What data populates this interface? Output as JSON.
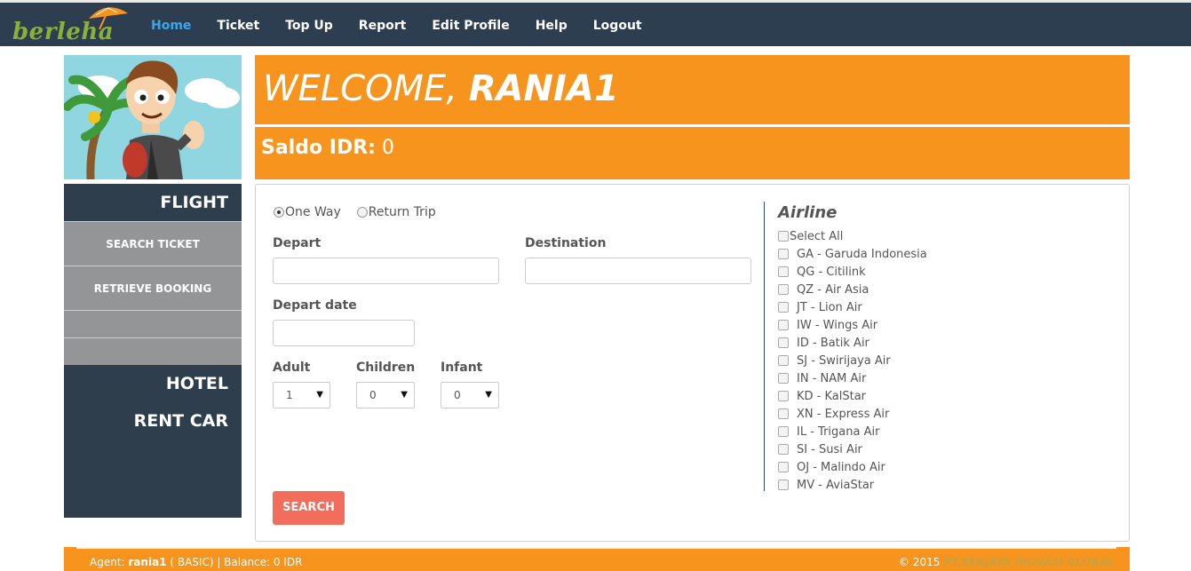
{
  "brand": {
    "logo_text": "berleha"
  },
  "nav": {
    "items": [
      {
        "label": "Home",
        "active": true
      },
      {
        "label": "Ticket"
      },
      {
        "label": "Top Up"
      },
      {
        "label": "Report"
      },
      {
        "label": "Edit Profile"
      },
      {
        "label": "Help"
      },
      {
        "label": "Logout"
      }
    ]
  },
  "sidebar": {
    "flight_label": "FLIGHT",
    "search_ticket": "SEARCH TICKET",
    "retrieve_booking": "RETRIEVE BOOKING",
    "hotel_label": "HOTEL",
    "rent_car_label": "RENT CAR"
  },
  "welcome": {
    "prefix": "WELCOME, ",
    "username": "RANIA1"
  },
  "saldo": {
    "label": "Saldo IDR:",
    "value": "0"
  },
  "form": {
    "trip_type": {
      "one_way": "One Way",
      "return_trip": "Return Trip",
      "selected": "One Way"
    },
    "depart_label": "Depart",
    "destination_label": "Destination",
    "depart_date_label": "Depart date",
    "adult_label": "Adult",
    "children_label": "Children",
    "infant_label": "Infant",
    "adult_value": "1",
    "children_value": "0",
    "infant_value": "0",
    "search_label": "SEARCH"
  },
  "airline": {
    "title": "Airline",
    "select_all": "Select All",
    "items": [
      "GA - Garuda Indonesia",
      "QG - Citilink",
      "QZ - Air Asia",
      "JT - Lion Air",
      "IW - Wings Air",
      "ID - Batik Air",
      "SJ - Swirijaya Air",
      "IN - NAM Air",
      "KD - KalStar",
      "XN - Express Air",
      "IL - Trigana Air",
      "SI - Susi Air",
      "OJ - Malindo Air",
      "MV - AviaStar"
    ]
  },
  "footer": {
    "agent_label": "Agent:",
    "agent_name": "rania1",
    "agent_rest": "( BASIC) | Balance: 0 IDR",
    "copyright": "© 2015",
    "company": "PT.BERJAYA INOVASI GLOBAL"
  },
  "colors": {
    "navbar": "#2c3e50",
    "accent": "#f7941d",
    "active_nav": "#3ca7e8",
    "search_button": "#f26d5b"
  }
}
